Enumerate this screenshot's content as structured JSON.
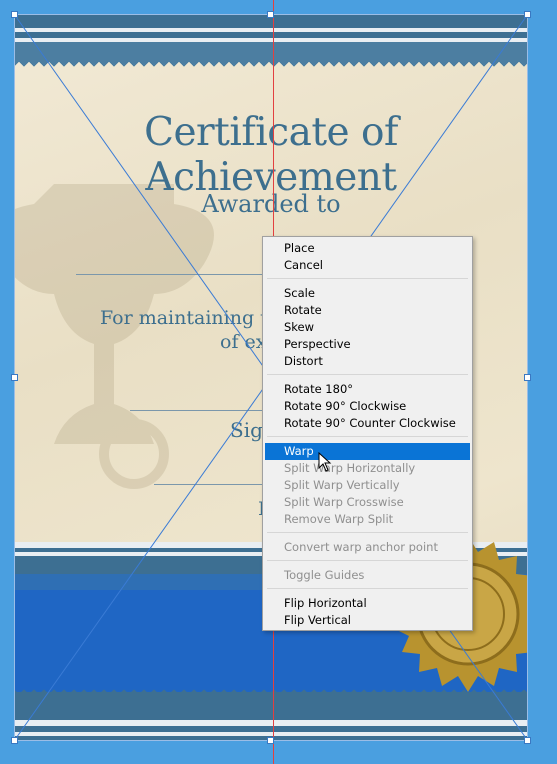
{
  "certificate": {
    "title": "Certificate of Achievement",
    "awarded": "Awarded to",
    "body_line1": "For maintaining t",
    "body_line2": "of ex",
    "signature_label": "Sig",
    "date_label": "I"
  },
  "context_menu": {
    "groups": [
      [
        {
          "label": "Place",
          "enabled": true
        },
        {
          "label": "Cancel",
          "enabled": true
        }
      ],
      [
        {
          "label": "Scale",
          "enabled": true
        },
        {
          "label": "Rotate",
          "enabled": true
        },
        {
          "label": "Skew",
          "enabled": true
        },
        {
          "label": "Perspective",
          "enabled": true
        },
        {
          "label": "Distort",
          "enabled": true
        }
      ],
      [
        {
          "label": "Rotate 180°",
          "enabled": true
        },
        {
          "label": "Rotate 90° Clockwise",
          "enabled": true
        },
        {
          "label": "Rotate 90° Counter Clockwise",
          "enabled": true
        }
      ],
      [
        {
          "label": "Warp",
          "enabled": true,
          "selected": true
        },
        {
          "label": "Split Warp Horizontally",
          "enabled": false
        },
        {
          "label": "Split Warp Vertically",
          "enabled": false
        },
        {
          "label": "Split Warp Crosswise",
          "enabled": false
        },
        {
          "label": "Remove Warp Split",
          "enabled": false
        }
      ],
      [
        {
          "label": "Convert warp anchor point",
          "enabled": false
        }
      ],
      [
        {
          "label": "Toggle Guides",
          "enabled": false
        }
      ],
      [
        {
          "label": "Flip Horizontal",
          "enabled": true
        },
        {
          "label": "Flip Vertical",
          "enabled": true
        }
      ]
    ]
  },
  "colors": {
    "background": "#4a9fe0",
    "accent_text": "#3d6f8e",
    "menu_highlight": "#0a74d6"
  }
}
